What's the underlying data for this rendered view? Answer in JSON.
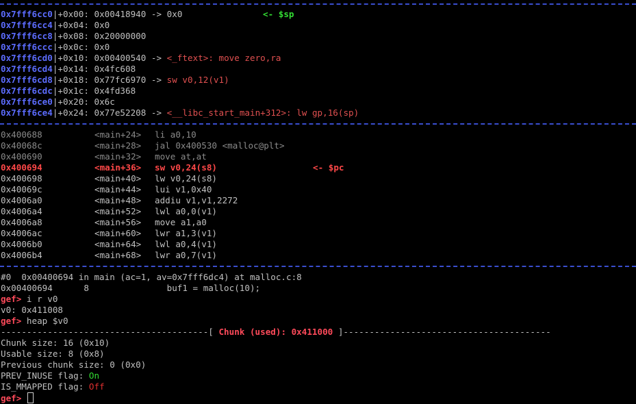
{
  "stack": [
    {
      "addr": "0x7fff6cc0",
      "off": "+0x00:",
      "val": "0x00418940 -> 0x0",
      "note": "<- $sp",
      "ref": ""
    },
    {
      "addr": "0x7fff6cc4",
      "off": "+0x04:",
      "val": "0x0",
      "note": "",
      "ref": ""
    },
    {
      "addr": "0x7fff6cc8",
      "off": "+0x08:",
      "val": "0x20000000",
      "note": "",
      "ref": ""
    },
    {
      "addr": "0x7fff6ccc",
      "off": "+0x0c:",
      "val": "0x0",
      "note": "",
      "ref": ""
    },
    {
      "addr": "0x7fff6cd0",
      "off": "+0x10:",
      "val": "0x00400540 -> ",
      "note": "",
      "ref": "<_ftext>: move zero,ra"
    },
    {
      "addr": "0x7fff6cd4",
      "off": "+0x14:",
      "val": "0x4fc608",
      "note": "",
      "ref": ""
    },
    {
      "addr": "0x7fff6cd8",
      "off": "+0x18:",
      "val": "0x77fc6970 -> ",
      "note": "",
      "ref": "sw v0,12(v1)"
    },
    {
      "addr": "0x7fff6cdc",
      "off": "+0x1c:",
      "val": "0x4fd368",
      "note": "",
      "ref": ""
    },
    {
      "addr": "0x7fff6ce0",
      "off": "+0x20:",
      "val": "0x6c",
      "note": "",
      "ref": ""
    },
    {
      "addr": "0x7fff6ce4",
      "off": "+0x24:",
      "val": "0x77e52208 -> ",
      "note": "",
      "ref": "<__libc_start_main+312>: lw gp,16(sp)"
    }
  ],
  "code": [
    {
      "addr": "0x400688",
      "sym": "<main+24>",
      "ins": "li a0,10",
      "style": "dim",
      "note": ""
    },
    {
      "addr": "0x40068c",
      "sym": "<main+28>",
      "ins": "jal 0x400530 <malloc@plt>",
      "style": "dim",
      "note": ""
    },
    {
      "addr": "0x400690",
      "sym": "<main+32>",
      "ins": "move at,at",
      "style": "dim",
      "note": ""
    },
    {
      "addr": "0x400694",
      "sym": "<main+36>",
      "ins": "sw v0,24(s8)",
      "style": "cur",
      "note": "<- $pc"
    },
    {
      "addr": "0x400698",
      "sym": "<main+40>",
      "ins": "lw v0,24(s8)",
      "style": "norm",
      "note": ""
    },
    {
      "addr": "0x40069c",
      "sym": "<main+44>",
      "ins": "lui v1,0x40",
      "style": "norm",
      "note": ""
    },
    {
      "addr": "0x4006a0",
      "sym": "<main+48>",
      "ins": "addiu v1,v1,2272",
      "style": "norm",
      "note": ""
    },
    {
      "addr": "0x4006a4",
      "sym": "<main+52>",
      "ins": "lwl a0,0(v1)",
      "style": "norm",
      "note": ""
    },
    {
      "addr": "0x4006a8",
      "sym": "<main+56>",
      "ins": "move a1,a0",
      "style": "norm",
      "note": ""
    },
    {
      "addr": "0x4006ac",
      "sym": "<main+60>",
      "ins": "lwr a1,3(v1)",
      "style": "norm",
      "note": ""
    },
    {
      "addr": "0x4006b0",
      "sym": "<main+64>",
      "ins": "lwl a0,4(v1)",
      "style": "norm",
      "note": ""
    },
    {
      "addr": "0x4006b4",
      "sym": "<main+68>",
      "ins": "lwr a0,7(v1)",
      "style": "norm",
      "note": ""
    }
  ],
  "trace": {
    "frame": "#0  0x00400694 in main (ac=1, av=0x7fff6dc4) at malloc.c:8",
    "source": "0x00400694      8               buf1 = malloc(10);"
  },
  "session": {
    "prompt": "gef> ",
    "cmd1": "i r v0",
    "out1": "v0: 0x411008",
    "cmd2": "heap $v0",
    "dash_left": "----------------------------------------[ ",
    "chunk_title": "Chunk (used): 0x411000",
    "dash_right": " ]----------------------------------------",
    "chunk_size": "Chunk size: 16 (0x10)",
    "usable_size": "Usable size: 8 (0x8)",
    "prev_chunk_size": "Previous chunk size: 0 (0x0)",
    "prev_inuse_label": "PREV_INUSE flag: ",
    "prev_inuse_val": "On",
    "is_mmapped_label": "IS_MMAPPED flag: ",
    "is_mmapped_val": "Off"
  },
  "colors": {
    "background": "#000000",
    "address": "#5c6cff",
    "separator": "#3a4ecf",
    "prompt": "#ff4a5a",
    "marker": "#33dd33",
    "reference": "#e05050"
  }
}
